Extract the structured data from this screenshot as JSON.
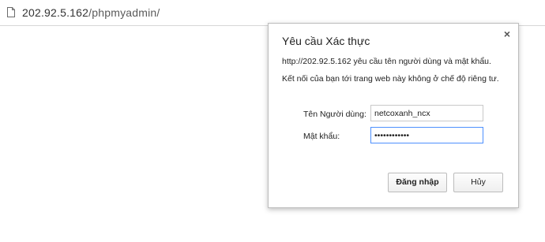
{
  "browser": {
    "url_host": "202.92.5.162",
    "url_path": "/phpmyadmin/"
  },
  "dialog": {
    "title": "Yêu cầu Xác thực",
    "close_icon": "×",
    "message_line1": "http://202.92.5.162 yêu cầu tên người dùng và mật khẩu.",
    "message_line2": "Kết nối của bạn tới trang web này không ở chế độ riêng tư.",
    "username_label": "Tên Người dùng:",
    "username_value": "netcoxanh_ncx",
    "password_label": "Mật khẩu:",
    "password_value": "••••••••••••",
    "login_button": "Đăng nhập",
    "cancel_button": "Hủy"
  }
}
